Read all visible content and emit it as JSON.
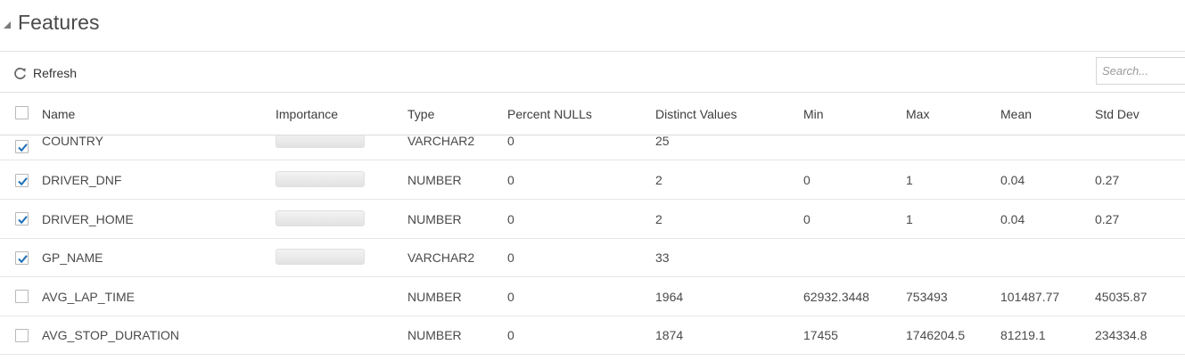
{
  "section": {
    "title": "Features"
  },
  "toolbar": {
    "refresh_label": "Refresh",
    "search_placeholder": "Search..."
  },
  "grid": {
    "columns": [
      "Name",
      "Importance",
      "Type",
      "Percent NULLs",
      "Distinct Values",
      "Min",
      "Max",
      "Mean",
      "Std Dev"
    ],
    "rows": [
      {
        "checked": true,
        "name": "COUNTRY",
        "type": "VARCHAR2",
        "percent_nulls": "0",
        "distinct": "25",
        "min": "",
        "max": "",
        "mean": "",
        "std_dev": "",
        "has_importance": true
      },
      {
        "checked": true,
        "name": "DRIVER_DNF",
        "type": "NUMBER",
        "percent_nulls": "0",
        "distinct": "2",
        "min": "0",
        "max": "1",
        "mean": "0.04",
        "std_dev": "0.27",
        "has_importance": true
      },
      {
        "checked": true,
        "name": "DRIVER_HOME",
        "type": "NUMBER",
        "percent_nulls": "0",
        "distinct": "2",
        "min": "0",
        "max": "1",
        "mean": "0.04",
        "std_dev": "0.27",
        "has_importance": true
      },
      {
        "checked": true,
        "name": "GP_NAME",
        "type": "VARCHAR2",
        "percent_nulls": "0",
        "distinct": "33",
        "min": "",
        "max": "",
        "mean": "",
        "std_dev": "",
        "has_importance": true
      },
      {
        "checked": false,
        "name": "AVG_LAP_TIME",
        "type": "NUMBER",
        "percent_nulls": "0",
        "distinct": "1964",
        "min": "62932.3448",
        "max": "753493",
        "mean": "101487.77",
        "std_dev": "45035.87",
        "has_importance": false
      },
      {
        "checked": false,
        "name": "AVG_STOP_DURATION",
        "type": "NUMBER",
        "percent_nulls": "0",
        "distinct": "1874",
        "min": "17455",
        "max": "1746204.5",
        "mean": "81219.1",
        "std_dev": "234334.8",
        "has_importance": false
      }
    ]
  },
  "colors": {
    "checkmark": "#1d6fb8",
    "border": "#e2e2e2"
  },
  "icons": {
    "collapse": "triangle-down-left-icon",
    "refresh": "refresh-icon",
    "check": "checkmark-icon"
  }
}
